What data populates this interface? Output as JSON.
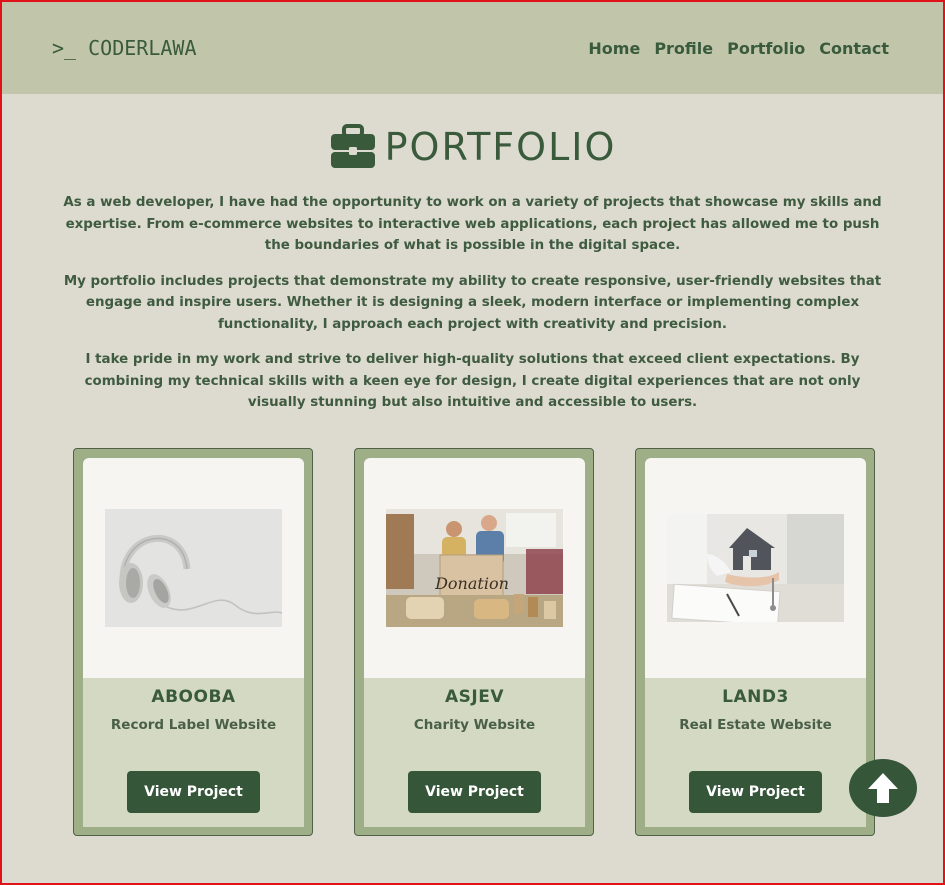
{
  "header": {
    "logo_text": ">_ CODERLAWA",
    "nav": [
      {
        "label": "Home"
      },
      {
        "label": "Profile"
      },
      {
        "label": "Portfolio"
      },
      {
        "label": "Contact"
      }
    ]
  },
  "main": {
    "title": "PORTFOLIO",
    "title_icon": "briefcase-icon",
    "paragraphs": [
      "As a web developer, I have had the opportunity to work on a variety of projects that showcase my skills and expertise. From e-commerce websites to interactive web applications, each project has allowed me to push the boundaries of what is possible in the digital space.",
      "My portfolio includes projects that demonstrate my ability to create responsive, user-friendly websites that engage and inspire users. Whether it is designing a sleek, modern interface or implementing complex functionality, I approach each project with creativity and precision.",
      "I take pride in my work and strive to deliver high-quality solutions that exceed client expectations. By combining my technical skills with a keen eye for design, I create digital experiences that are not only visually stunning but also intuitive and accessible to users."
    ],
    "cards": [
      {
        "name": "ABOOBA",
        "description": "Record Label Website",
        "button_label": "View Project",
        "image": "headphones-image"
      },
      {
        "name": "ASJEV",
        "description": "Charity Website",
        "button_label": "View Project",
        "image": "donation-image"
      },
      {
        "name": "LAND3",
        "description": "Real Estate Website",
        "button_label": "View Project",
        "image": "house-keys-image"
      }
    ]
  },
  "scroll_top": {
    "icon": "arrow-up-icon"
  },
  "colors": {
    "page_bg": "#dddbd0",
    "header_bg": "#c1c6aa",
    "accent_dark": "#36563a",
    "card_frame": "#9eaf88"
  }
}
